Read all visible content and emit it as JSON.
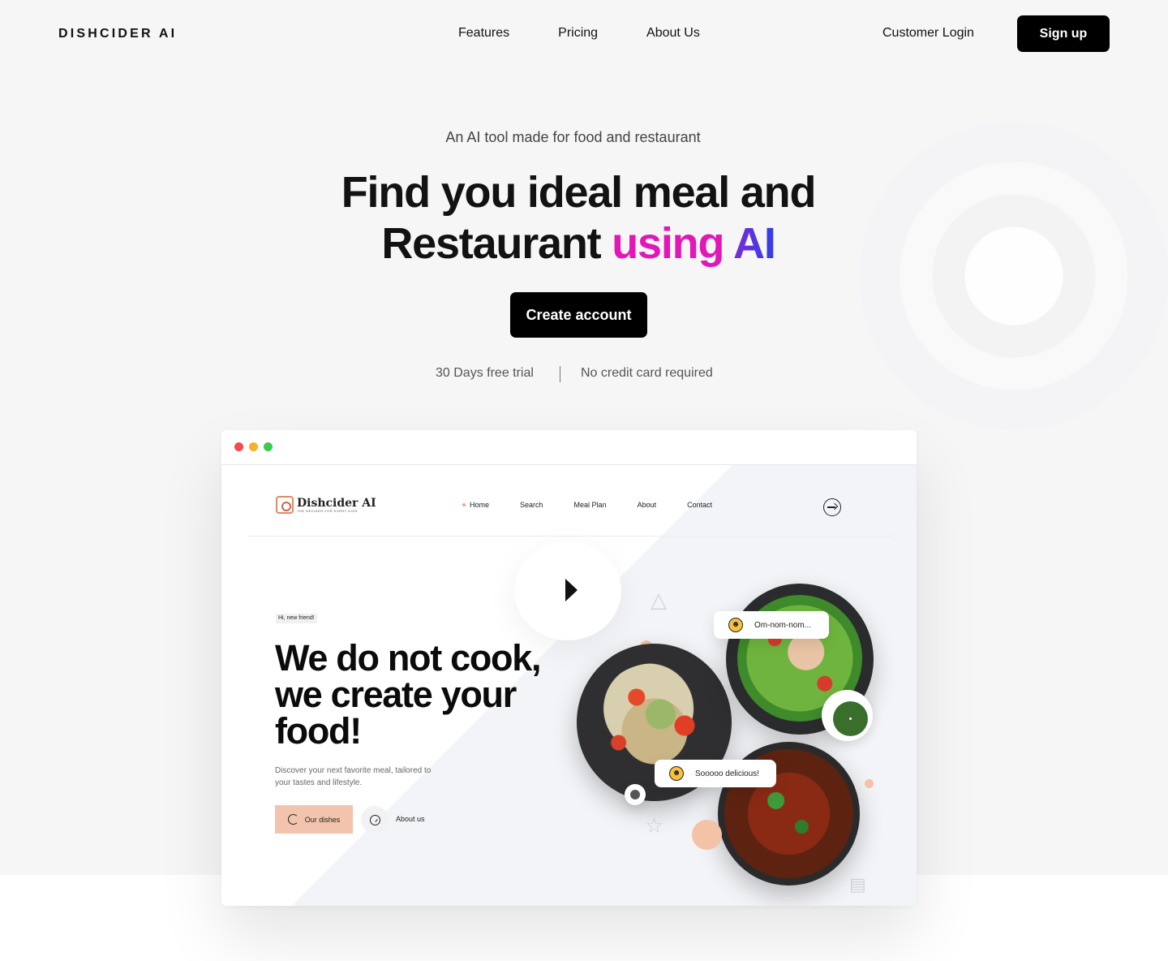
{
  "nav": {
    "logo": "DISHCIDER AI",
    "links": [
      "Features",
      "Pricing",
      "About Us"
    ],
    "login": "Customer Login",
    "signup": "Sign up"
  },
  "hero": {
    "eyebrow": "An AI tool made for food and restaurant",
    "title_line1": "Find you ideal meal and",
    "title_line2_plain": "Restaurant ",
    "title_line2_using": "using",
    "title_line2_ai": "AI",
    "cta": "Create account",
    "trial": "30 Days free trial",
    "no_card": "No credit card required"
  },
  "preview": {
    "brand": "Dishcider AI",
    "brand_tagline": "THE DECIDER FOR EVERY DISH",
    "nav": [
      "Home",
      "Search",
      "Meal Plan",
      "About",
      "Contact"
    ],
    "badge": "Hi, new friend!",
    "title": "We do not cook, we create your food!",
    "description": "Discover your next favorite meal, tailored to your tastes and lifestyle.",
    "dishes_button": "Our dishes",
    "about_button": "About us",
    "chip1": "Om-nom-nom...",
    "chip2": "Sooooo delicious!"
  },
  "colors": {
    "accent_pink": "#e316b8",
    "accent_blue": "#2f3fe6",
    "peach": "#f3c4ad"
  }
}
